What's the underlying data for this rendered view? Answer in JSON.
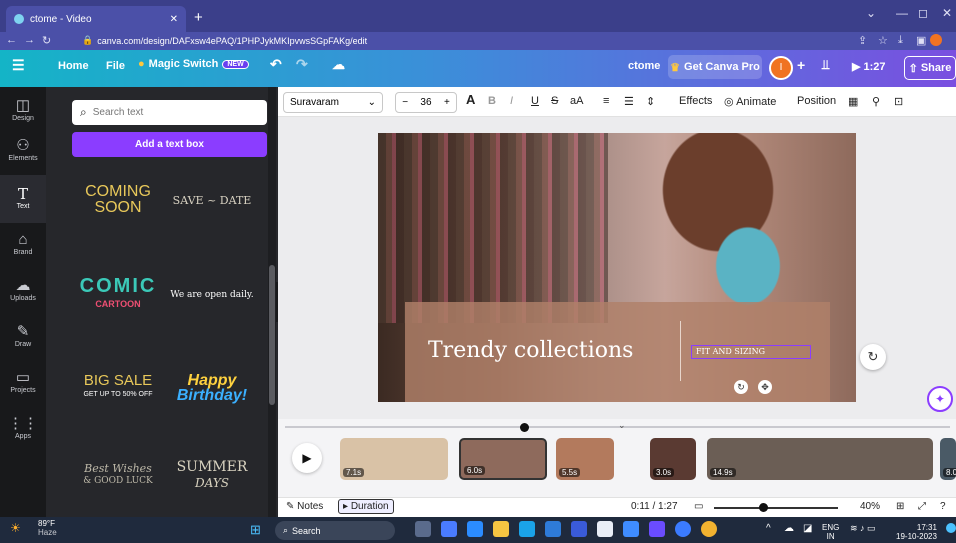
{
  "browser": {
    "tab_title": "ctome - Video",
    "url": "canva.com/design/DAFxsw4ePAQ/1PHPJykMKIpvwsSGpFAKg/edit"
  },
  "topbar": {
    "menu_icon": "hamburger-icon",
    "home": "Home",
    "file": "File",
    "magic_switch": "Magic Switch",
    "new_badge": "NEW",
    "doc_name": "ctome",
    "get_pro": "Get Canva Pro",
    "avatar_initial": "I",
    "plus": "+",
    "play_time": "1:27",
    "share": "Share"
  },
  "rail": [
    {
      "label": "Design",
      "icon": "◫"
    },
    {
      "label": "Elements",
      "icon": "⚇"
    },
    {
      "label": "Text",
      "icon": "T"
    },
    {
      "label": "Brand",
      "icon": "⌂"
    },
    {
      "label": "Uploads",
      "icon": "☁"
    },
    {
      "label": "Draw",
      "icon": "✎"
    },
    {
      "label": "Projects",
      "icon": "▭"
    },
    {
      "label": "Apps",
      "icon": "⋮⋮"
    }
  ],
  "panel": {
    "search_placeholder": "Search text",
    "add_text": "Add a text box",
    "presets": [
      {
        "line1": "COMING",
        "line2": "SOON"
      },
      {
        "line1": "SAVE ~ DATE",
        "line2": ""
      },
      {
        "line1": "COMIC",
        "line2": "CARTOON"
      },
      {
        "line1": "We are open daily.",
        "line2": ""
      },
      {
        "line1": "BIG SALE",
        "line2": "GET UP TO 50% OFF"
      },
      {
        "line1": "Happy",
        "line2": "Birthday!"
      },
      {
        "line1": "Best Wishes",
        "line2": "& GOOD LUCK"
      },
      {
        "line1": "SUMMER",
        "line2": "DAYS"
      }
    ]
  },
  "toolbar": {
    "font": "Suravaram",
    "minus": "−",
    "size": "36",
    "plus": "+",
    "effects": "Effects",
    "animate": "Animate",
    "position": "Position"
  },
  "canvas": {
    "headline": "Trendy collections",
    "subline": "FIT AND SIZING"
  },
  "timeline": {
    "clips": [
      {
        "duration": "7.1s",
        "color": "#d9c2a6"
      },
      {
        "duration": "6.0s",
        "color": "#8e6a5c"
      },
      {
        "duration": "5.5s",
        "color": "#b37a5d"
      },
      {
        "duration": "3.0s",
        "color": "#5a3a32"
      },
      {
        "duration": "14.9s",
        "color": "#6b5e55"
      },
      {
        "duration": "8.0",
        "color": "#4a5a66"
      }
    ]
  },
  "status": {
    "notes": "Notes",
    "duration": "Duration",
    "time": "0:11 / 1:27",
    "zoom": "40%"
  },
  "taskbar": {
    "temp": "89°F",
    "weather": "Haze",
    "search": "Search",
    "lang": "ENG",
    "region": "IN",
    "time": "17:31",
    "date": "19-10-2023"
  }
}
